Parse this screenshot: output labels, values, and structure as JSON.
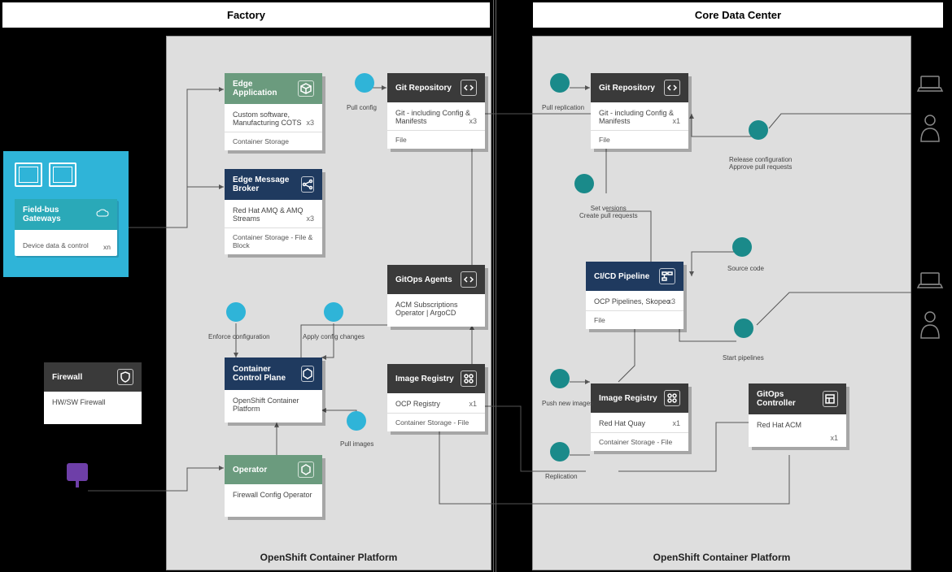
{
  "zones": {
    "factory": "Factory",
    "core": "Core Data Center",
    "platform": "OpenShift Container Platform"
  },
  "factory": {
    "edgeApp": {
      "title": "Edge Application",
      "desc": "Custom software, Manufacturing COTS",
      "count": "x3",
      "bar": "Container Storage"
    },
    "edgeMsg": {
      "title": "Edge Message Broker",
      "desc": "Red Hat AMQ & AMQ Streams",
      "count": "x3",
      "bar": "Container Storage - File & Block"
    },
    "gitRepo": {
      "title": "Git Repository",
      "desc": "Git - including Config & Manifests",
      "count": "x3",
      "bar": "File"
    },
    "gitops": {
      "title": "GitOps Agents",
      "desc": "ACM Subscriptions Operator | ArgoCD"
    },
    "ccp": {
      "title": "Container Control Plane",
      "desc": "OpenShift Container Platform"
    },
    "registry": {
      "title": "Image Registry",
      "desc": "OCP Registry",
      "count": "x1",
      "bar": "Container Storage - File"
    },
    "operator": {
      "title": "Operator",
      "desc": "Firewall Config Operator"
    }
  },
  "core": {
    "gitRepo": {
      "title": "Git Repository",
      "desc": "Git - including Config & Manifests",
      "count": "x1",
      "bar": "File"
    },
    "pipeline": {
      "title": "CI/CD Pipeline",
      "desc": "OCP Pipelines, Skopeo",
      "count": "x3",
      "bar": "File"
    },
    "registry": {
      "title": "Image Registry",
      "desc": "Red Hat Quay",
      "count": "x1",
      "bar": "Container Storage - File"
    },
    "gitopsCtrl": {
      "title": "GitOps Controller",
      "desc": "Red Hat ACM",
      "count": "x1"
    }
  },
  "left": {
    "gateway": {
      "title": "Field-bus Gateways",
      "desc": "Device data & control",
      "count": "xn"
    },
    "firewall": {
      "title": "Firewall",
      "desc": "HW/SW Firewall"
    }
  },
  "labels": {
    "pullConfig": "Pull config",
    "enforce": "Enforce configuration",
    "applyChanges": "Apply config changes",
    "pullImages": "Pull images",
    "pullRepl": "Pull replication",
    "setVersions": "Set versions\nCreate pull requests",
    "pushImages": "Push new images",
    "replication": "Replication",
    "releaseCfg": "Release configuration\nApprove pull requests",
    "sourceCode": "Source code",
    "startPipe": "Start pipelines"
  }
}
